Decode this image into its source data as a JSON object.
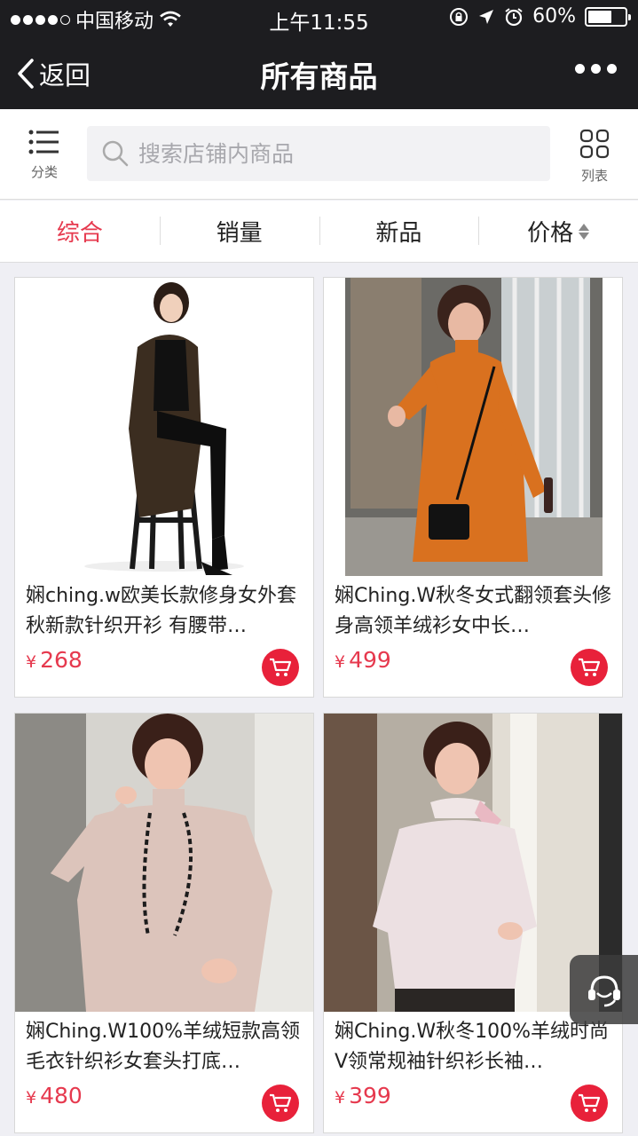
{
  "status_bar": {
    "carrier": "中国移动",
    "time": "上午11:55",
    "battery_pct": "60%",
    "battery_level": 0.6,
    "signal_bars_filled": 4
  },
  "nav": {
    "back_label": "返回",
    "title": "所有商品"
  },
  "search": {
    "category_label": "分类",
    "placeholder": "搜索店铺内商品",
    "list_label": "列表"
  },
  "sort_tabs": [
    {
      "label": "综合",
      "active": true
    },
    {
      "label": "销量",
      "active": false
    },
    {
      "label": "新品",
      "active": false
    },
    {
      "label": "价格",
      "active": false
    }
  ],
  "products": [
    {
      "title": "娴ching.w欧美长款修身女外套秋新款针织开衫 有腰带…",
      "currency": "¥",
      "price": "268"
    },
    {
      "title": "娴Ching.W秋冬女式翻领套头修身高领羊绒衫女中长…",
      "currency": "¥",
      "price": "499"
    },
    {
      "title": "娴Ching.W100%羊绒短款高领毛衣针织衫女套头打底…",
      "currency": "¥",
      "price": "480"
    },
    {
      "title": "娴Ching.W秋冬100%羊绒时尚V领常规袖针织衫长袖…",
      "currency": "¥",
      "price": "399"
    }
  ],
  "colors": {
    "accent": "#e6394e",
    "nav_bg": "#1d1d20",
    "cart": "#e8213a"
  }
}
